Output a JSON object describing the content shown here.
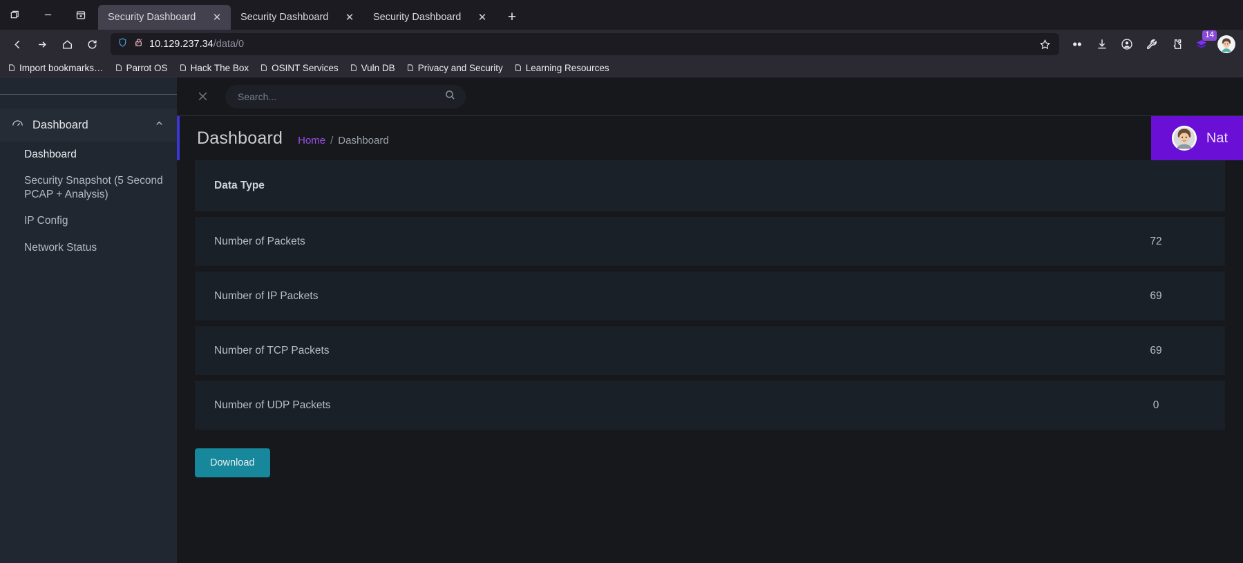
{
  "browser": {
    "window_controls": [
      {
        "name": "restore-window",
        "icon": "restore-icon"
      },
      {
        "name": "minimize-window",
        "icon": "minimize-icon"
      },
      {
        "name": "firefox-view",
        "icon": "firefox-view-icon"
      }
    ],
    "tabs": [
      {
        "title": "Security Dashboard",
        "active": true
      },
      {
        "title": "Security Dashboard",
        "active": false
      },
      {
        "title": "Security Dashboard",
        "active": false
      }
    ],
    "new_tab_label": "+",
    "nav": {
      "back": "back-icon",
      "forward": "forward-icon",
      "home": "home-icon",
      "reload": "reload-icon"
    },
    "url": {
      "host": "10.129.237.34",
      "path": "/data/0",
      "shield": "shield-icon",
      "lock": "lock-crossed-icon"
    },
    "toolbar_icons": [
      {
        "name": "bookmark-star-icon",
        "glyph": "star"
      },
      {
        "name": "password-manager-icon",
        "glyph": "infinity"
      },
      {
        "name": "downloads-icon",
        "glyph": "download"
      },
      {
        "name": "account-icon",
        "glyph": "account"
      },
      {
        "name": "tools-icon",
        "glyph": "wrench"
      },
      {
        "name": "extensions-icon",
        "glyph": "puzzle"
      },
      {
        "name": "layers-extension-icon",
        "glyph": "layers",
        "badge": "14"
      },
      {
        "name": "profile-avatar-icon",
        "glyph": "avatar"
      }
    ],
    "bookmarks": [
      "Import bookmarks…",
      "Parrot OS",
      "Hack The Box",
      "OSINT Services",
      "Vuln DB",
      "Privacy and Security",
      "Learning Resources"
    ]
  },
  "sidebar": {
    "group": {
      "label": "Dashboard",
      "icon": "speedometer-icon",
      "chevron": "chevron-up-icon"
    },
    "items": [
      {
        "label": "Dashboard",
        "selected": true
      },
      {
        "label": "Security Snapshot (5 Second PCAP + Analysis)",
        "selected": false
      },
      {
        "label": "IP Config",
        "selected": false
      },
      {
        "label": "Network Status",
        "selected": false
      }
    ]
  },
  "topbar": {
    "close_icon": "close-icon",
    "search_placeholder": "Search...",
    "search_value": "",
    "search_icon": "search-icon"
  },
  "page": {
    "title": "Dashboard",
    "breadcrumb": {
      "home": "Home",
      "separator": "/",
      "current": "Dashboard"
    },
    "user": {
      "name": "Nat",
      "avatar": "user-avatar"
    },
    "accent_color": "#3b36d6",
    "banner_color": "#6a0fd6"
  },
  "table": {
    "header": {
      "col1": "Data Type",
      "col2": ""
    },
    "rows": [
      {
        "label": "Number of Packets",
        "value": "72"
      },
      {
        "label": "Number of IP Packets",
        "value": "69"
      },
      {
        "label": "Number of TCP Packets",
        "value": "69"
      },
      {
        "label": "Number of UDP Packets",
        "value": "0"
      }
    ]
  },
  "actions": {
    "download_label": "Download",
    "download_color": "#17879b"
  },
  "annotation": {
    "color": "#ff0000",
    "target": "values-column"
  }
}
